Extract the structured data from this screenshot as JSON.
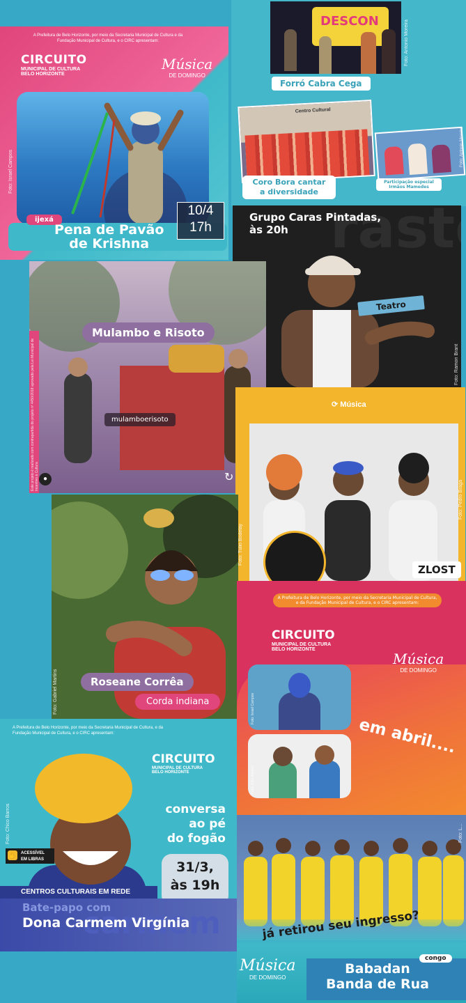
{
  "posters": {
    "pena": {
      "presenter": "A Prefeitura de Belo Horizonte, por meio da Secretaria Municipal de Cultura e da Fundação Municipal de Cultura, e o CIRC apresentam:",
      "brand": "CIRCUITO",
      "brand_sub1": "MUNICIPAL DE CULTURA",
      "brand_sub2": "BELO HORIZONTE",
      "musica": "Música",
      "musica_sub": "DE DOMINGO",
      "photo_credit": "Foto: Israel Campos",
      "genre": "ijexá",
      "title_line1": "Pena de Pavão",
      "title_line2": "de Krishna",
      "date": "10/4",
      "time": "17h"
    },
    "forro": {
      "banner_text": "DESCON",
      "label": "Forró Cabra Cega",
      "photo_credit": "Foto: Antonio Moreira",
      "coro_line1": "Coro Bora cantar",
      "coro_line2": "a diversidade",
      "sign_text": "Centro Cultural",
      "special_line1": "Participação especial",
      "special_line2": "Irmãos Mamedes",
      "photo_credit2": "Foto: Antonio Moreira"
    },
    "caras": {
      "bg_text": "rasteira",
      "title_line1": "Grupo Caras Pintadas,",
      "title_line2": "às 20h",
      "tag": "Teatro",
      "photo_credit": "Foto: Ramon Brant"
    },
    "mulambo": {
      "title": "Mulambo e Risoto",
      "handle": "mulamboerisoto",
      "side_text": "Este projeto é realizado com contrapartida do projeto nº 4450/2018 aprovado pela Lei Municipal de Incentivo à Cultura"
    },
    "zlost": {
      "category": "Música",
      "name": "ZLOST",
      "photo_credit": "Foto: Pedro Braga",
      "photo_credit2": "Foto: Túlio Bodelay"
    },
    "roseane": {
      "name": "Roseane Corrêa",
      "subtitle": "Corda indiana",
      "photo_credit": "Foto: Gabriel Martins"
    },
    "abril": {
      "presenter": "A Prefeitura de Belo Horizonte, por meio da Secretaria Municipal de Cultura, e da Fundação Municipal de Cultura, e o CIRC apresentam:",
      "brand": "CIRCUITO",
      "brand_sub1": "MUNICIPAL DE CULTURA",
      "brand_sub2": "BELO HORIZONTE",
      "musica": "Música",
      "musica_sub": "DE DOMINGO",
      "slogan": "em abril....",
      "photo_credit": "Foto: Israel Campos",
      "photo_credit2": "Foto: Julia Gomes"
    },
    "carmem": {
      "presenter": "A Prefeitura de Belo Horizonte, por meio da Secretaria Municipal de Cultura, e da Fundação Municipal de Cultura, e o CIRC apresentam:",
      "brand": "CIRCUITO",
      "brand_sub1": "MUNICIPAL DE CULTURA",
      "brand_sub2": "BELO HORIZONTE",
      "headline_line1": "conversa",
      "headline_line2": "ao pé",
      "headline_line3": "do fogão",
      "date_line1": "31/3,",
      "date_line2": "às 19h",
      "accessible_line1": "ACESSÍVEL",
      "accessible_line2": "EM LIBRAS",
      "network": "CENTROS CULTURAIS EM REDE",
      "subtitle": "Bate-papo com",
      "name": "Dona Carmem Virgínia",
      "bg_text": "carmem",
      "photo_credit": "Foto: Chico Barros"
    },
    "babadan": {
      "slogan_part1": "já retirou",
      "slogan_part2": "seu ingresso?",
      "genre": "congo",
      "title_line1": "Babadan",
      "title_line2": "Banda de Rua",
      "musica": "Música",
      "musica_sub": "DE DOMINGO",
      "photo_credit": "Foto: L..."
    }
  },
  "colors": {
    "background": "#37a8c6",
    "pink": "#e0457b",
    "teal": "#3fb9c9",
    "orange": "#f28a2e",
    "yellow": "#f6b82b",
    "purple": "#8e6f9f",
    "dark": "#1c1c1c"
  }
}
